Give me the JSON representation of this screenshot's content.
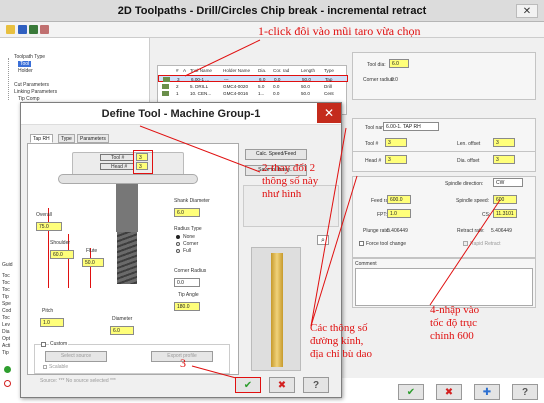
{
  "window": {
    "title": "2D Toolpaths - Drill/Circles Chip break - incremental retract",
    "close_glyph": "✕"
  },
  "tree": {
    "items": [
      "Toolpath Type",
      "Tool",
      "Holder",
      "Cut Parameters",
      "Linking Parameters",
      "Tip Comp"
    ]
  },
  "tool_table": {
    "headers": [
      "#",
      "A",
      "Tool Name",
      "Holder Name",
      "Dia.",
      "Cor. rad",
      "Length",
      "Type"
    ],
    "rows": [
      [
        "3",
        "",
        "6.00-1 ...",
        "---",
        "6.0",
        "0.0",
        "50.0",
        "Tap"
      ],
      [
        "2",
        "",
        "5. DRILL",
        "GMC4-0020",
        "5.0",
        "0.0",
        "50.0",
        "Drill"
      ],
      [
        "1",
        "",
        "10. CEN...",
        "GMC4-0016",
        "1...",
        "0.0",
        "50.0",
        "Cent"
      ]
    ]
  },
  "right_panel": {
    "tool_dia_label": "Tool dia:",
    "tool_dia_value": "6.0",
    "corner_radius_label": "Corner radius:",
    "corner_radius_value": "0.0",
    "tool_name_label": "Tool name:",
    "tool_name_value": "6.00-1. TAP RH",
    "tool_num_label": "Tool #",
    "tool_num_value": "3",
    "len_offset_label": "Len. offset",
    "len_offset_value": "3",
    "head_num_label": "Head #",
    "head_num_value": "3",
    "dia_offset_label": "Dia. offset",
    "dia_offset_value": "3",
    "spindle_dir_label": "Spindle direction:",
    "spindle_dir_value": "CW",
    "feed_rate_label": "Feed rate:",
    "feed_rate_value": "600.0",
    "spindle_speed_label": "Spindle speed:",
    "spindle_speed_value": "600",
    "fpt_label": "FPT:",
    "fpt_value": "1.0",
    "cs_label": "CS:",
    "cs_value": "11.3101",
    "plunge_rate_label": "Plunge rate:",
    "plunge_rate_value": "5.406449",
    "retract_rate_label": "Retract rate:",
    "retract_rate_value": "5.406449",
    "force_tool_change_label": "Force tool change",
    "rapid_retract_label": "Rapid Retract",
    "comment_label": "Comment"
  },
  "dialog": {
    "title": "Define Tool - Machine Group-1",
    "close_glyph": "✕",
    "tabs": [
      "Tap RH",
      "Type",
      "Parameters"
    ],
    "tool_num_label": "Tool #",
    "tool_num_value": "3",
    "head_num_label": "Head #",
    "head_num_value": "3",
    "calc_button": "Calc. Speed/Feed",
    "save_button": "Save to library...",
    "shank_diameter_label": "Shank Diameter",
    "shank_diameter_value": "6.0",
    "radius_type_label": "Radius Type",
    "radius_options": [
      "None",
      "Corner",
      "Full"
    ],
    "overall_label": "Overall",
    "overall_value": "75.0",
    "shoulder_label": "Shoulder",
    "shoulder_value": "60.0",
    "flute_label": "Flute",
    "flute_value": "50.0",
    "corner_radius_label": "Corner Radius",
    "corner_radius_value": "0.0",
    "tip_angle_label": "Tip Angle",
    "tip_angle_value": "180.0",
    "pitch_label": "Pitch",
    "pitch_value": "1.0",
    "diameter_label": "Diameter",
    "diameter_value": "6.0",
    "custom_label": "Custom",
    "select_source": "Select source",
    "export_profile": "Export profile",
    "scalable_label": "Scalable",
    "source_note": "Source: *** No source selected ***"
  },
  "annotations": {
    "a1": "1-click đôi vào mũi taro vừa chọn",
    "a2_line1": "2-thay đổi 2",
    "a2_line2": "thông số này",
    "a2_line3": "như hình",
    "a3": "3",
    "a4_line1": "4-nhập vào",
    "a4_line2": "tốc độ trục",
    "a4_line3": "chính 600",
    "a5_line1": "Các thông số",
    "a5_line2": "đường kính,",
    "a5_line3": "địa chỉ bù dao"
  },
  "left_stub": {
    "labels": [
      "Guid",
      "Toc",
      "Toc",
      "Toc",
      "Tip",
      "Spe",
      "Cod",
      "Toc",
      "Lev",
      "Dia",
      "Opt",
      "Acti",
      "Tip"
    ]
  },
  "colors": {
    "annotation_red": "#e01010",
    "field_yellow": "#ffff7a",
    "ok_green": "#2e9e2e",
    "cancel_red": "#d32020"
  }
}
